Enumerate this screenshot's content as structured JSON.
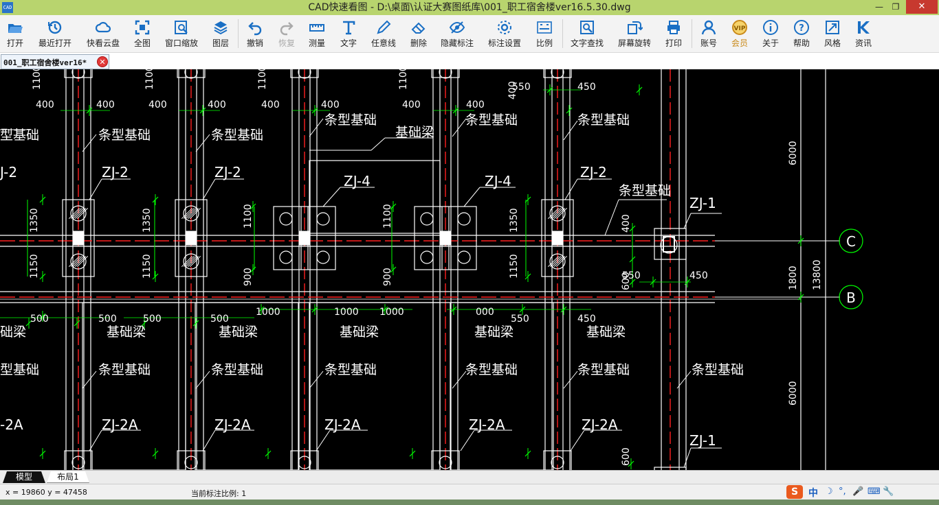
{
  "window": {
    "app_logo": "CAD",
    "title": "CAD快速看图 - D:\\桌面\\认证大赛图纸库\\001_职工宿舍楼ver16.5.30.dwg",
    "min": "—",
    "max": "❐",
    "close": "✕"
  },
  "toolbar": {
    "items": [
      {
        "label": "打开",
        "icon": "folder-open-icon"
      },
      {
        "label": "最近打开",
        "icon": "history-icon"
      },
      {
        "label": "快看云盘",
        "icon": "cloud-icon"
      },
      {
        "label": "全图",
        "icon": "fullview-icon"
      },
      {
        "label": "窗口缩放",
        "icon": "zoom-window-icon"
      },
      {
        "label": "图层",
        "icon": "layers-icon"
      },
      {
        "label": "撤销",
        "icon": "undo-icon"
      },
      {
        "label": "恢复",
        "icon": "redo-icon"
      },
      {
        "label": "测量",
        "icon": "ruler-icon"
      },
      {
        "label": "文字",
        "icon": "text-icon"
      },
      {
        "label": "任意线",
        "icon": "pen-icon"
      },
      {
        "label": "删除",
        "icon": "eraser-icon"
      },
      {
        "label": "隐藏标注",
        "icon": "eye-hide-icon"
      },
      {
        "label": "标注设置",
        "icon": "settings-icon"
      },
      {
        "label": "比例",
        "icon": "scale-icon"
      },
      {
        "label": "文字查找",
        "icon": "text-search-icon"
      },
      {
        "label": "屏幕旋转",
        "icon": "rotate-icon"
      },
      {
        "label": "打印",
        "icon": "print-icon"
      },
      {
        "label": "账号",
        "icon": "user-icon"
      },
      {
        "label": "会员",
        "icon": "vip-icon"
      },
      {
        "label": "关于",
        "icon": "info-icon"
      },
      {
        "label": "帮助",
        "icon": "help-icon"
      },
      {
        "label": "风格",
        "icon": "style-icon"
      },
      {
        "label": "资讯",
        "icon": "news-icon"
      }
    ],
    "accent": "#1a6fc4",
    "vip_color": "#c98a1a"
  },
  "document_tab": {
    "label": "001_职工宿舍楼ver16*",
    "close": "✕"
  },
  "drawing": {
    "texts": {
      "d1100": "1100",
      "d400": "400",
      "d550": "550",
      "d450": "450",
      "d500": "500",
      "d1000": "1000",
      "d1350": "1350",
      "d1150": "1150",
      "d900": "900",
      "d600": "600",
      "d6000": "6000",
      "d1800": "1800",
      "d13800": "13800",
      "strip_foundation": "条型基础",
      "foundation_beam": "基础梁",
      "zj1": "ZJ-1",
      "zj2": "ZJ-2",
      "zj2a": "ZJ-2A",
      "zj4": "ZJ-4",
      "zj2_cut": "J-2",
      "zj2a_cut": "-2A",
      "strip_cut": "型基础",
      "beam_cut": "础梁",
      "d1000_cut": "000",
      "axis_c": "C",
      "axis_b": "B"
    },
    "colors": {
      "bg": "#000000",
      "line": "#ffffff",
      "axis": "#ff2020",
      "dim": "#00ff00"
    }
  },
  "layout_tabs": {
    "model": "模型",
    "layout1": "布局1"
  },
  "status": {
    "coords": "x = 19860  y = 47458",
    "scale": "当前标注比例: 1"
  },
  "ime": {
    "logo": "S",
    "lang": "中",
    "glyphs": [
      "☽",
      "°,",
      "🎤",
      "⌨",
      "🔧"
    ]
  }
}
